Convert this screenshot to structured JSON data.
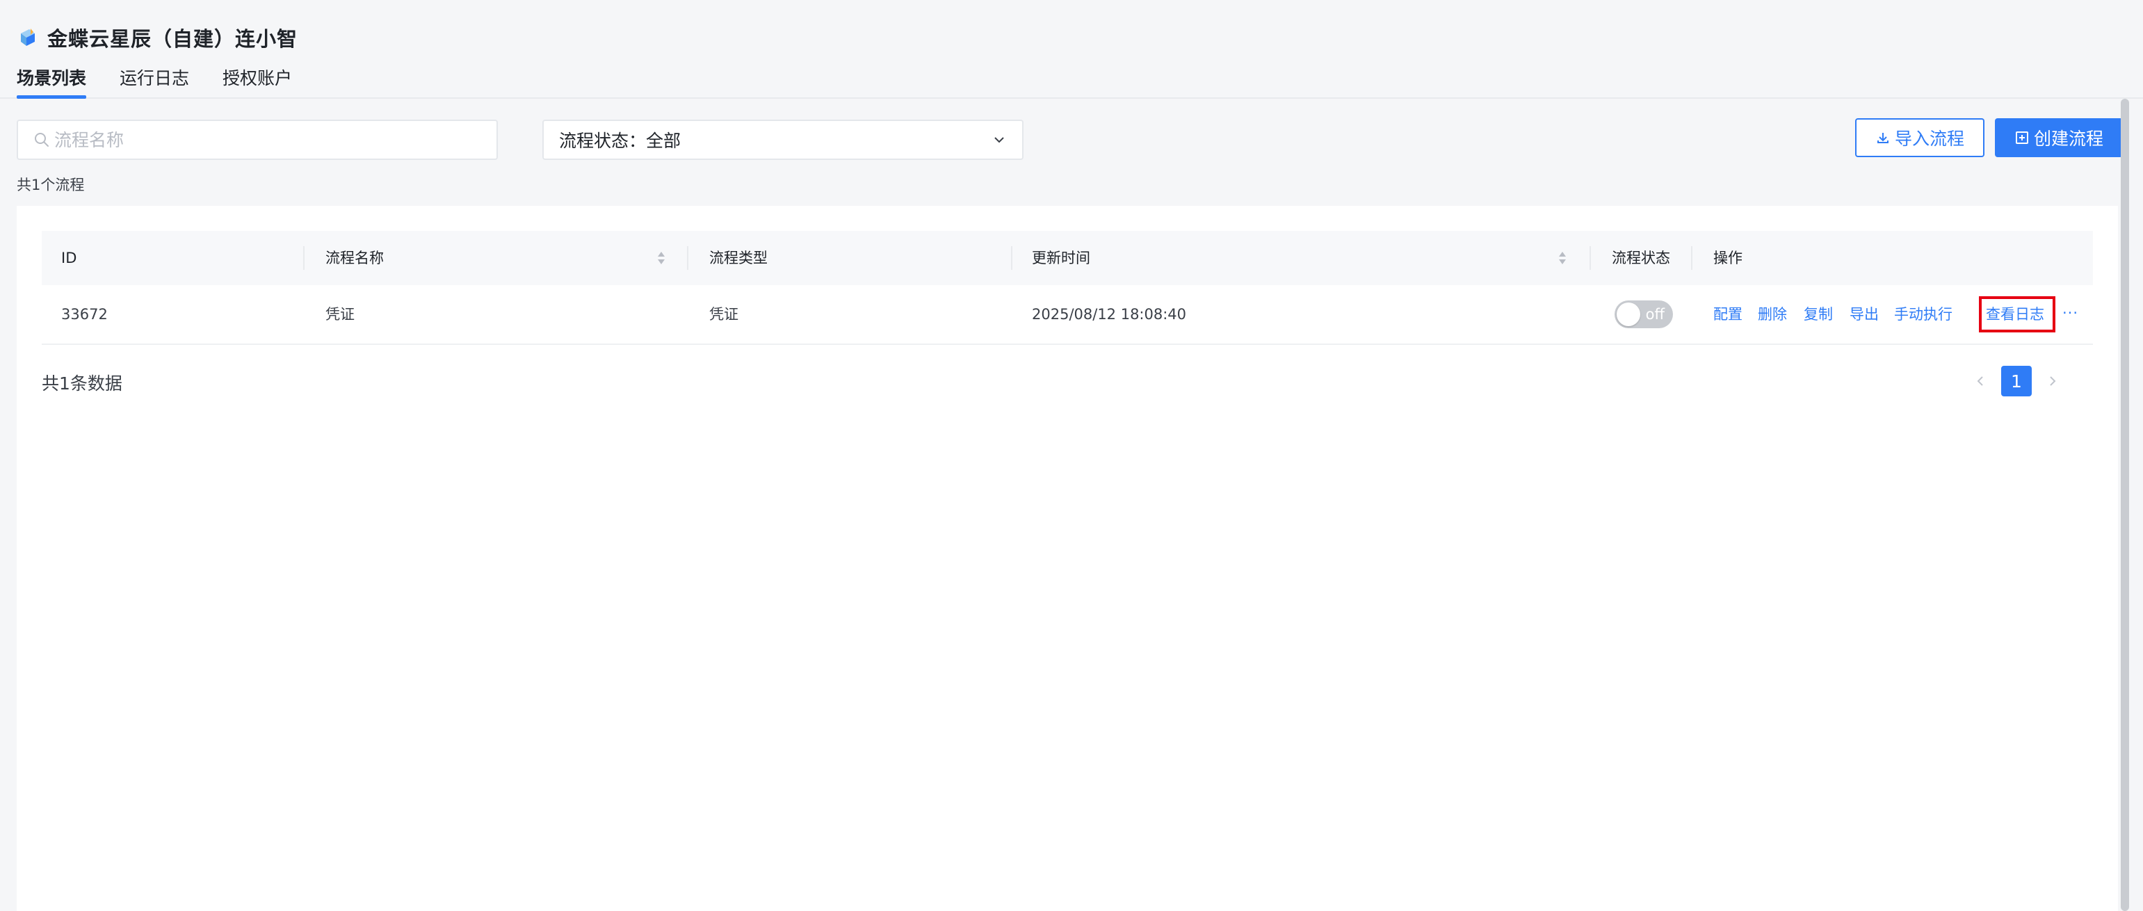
{
  "app": {
    "title": "金蝶云星辰（自建）连小智"
  },
  "tabs": [
    {
      "label": "场景列表",
      "active": true
    },
    {
      "label": "运行日志",
      "active": false
    },
    {
      "label": "授权账户",
      "active": false
    }
  ],
  "filters": {
    "search_placeholder": "流程名称",
    "status_label": "流程状态：全部"
  },
  "actions": {
    "import_label": "导入流程",
    "create_label": "创建流程"
  },
  "summary": {
    "count_text": "共1个流程"
  },
  "table": {
    "columns": [
      "ID",
      "流程名称",
      "流程类型",
      "更新时间",
      "流程状态",
      "操作"
    ],
    "rows": [
      {
        "id": "33672",
        "name": "凭证",
        "type": "凭证",
        "updated": "2025/08/12 18:08:40",
        "status_text": "off",
        "ops": [
          "配置",
          "删除",
          "复制",
          "导出",
          "手动执行",
          "查看日志"
        ],
        "more": "···"
      }
    ]
  },
  "pagination": {
    "total_text": "共1条数据",
    "current_page": "1"
  },
  "colors": {
    "accent": "#2f7cf6",
    "highlight": "#e60012",
    "toggle_off": "#c8cbd0"
  }
}
